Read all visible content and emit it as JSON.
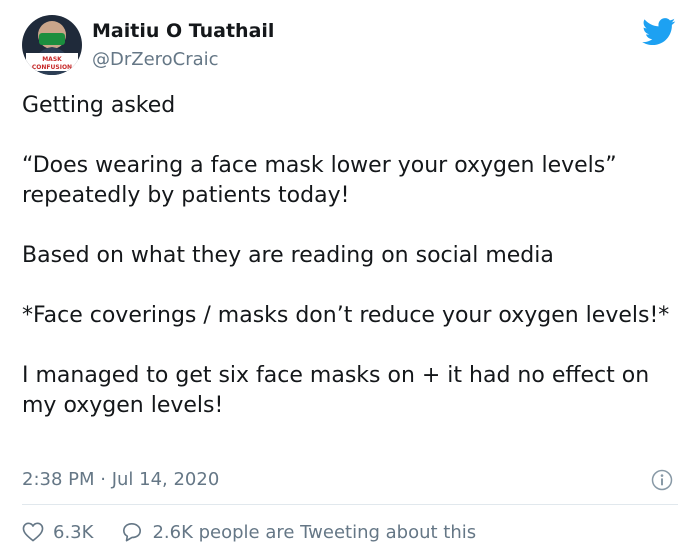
{
  "author": {
    "name": "Maitiu O Tuathail",
    "handle": "@DrZeroCraic",
    "avatar_caption_line1": "MASK",
    "avatar_caption_line2": "CONFUSION"
  },
  "tweet": {
    "lines": [
      "Getting asked",
      "“Does wearing a face mask lower your oxygen levels” repeatedly by patients today!",
      "Based on what they are reading on social media",
      "*Face coverings / masks don’t reduce your oxygen levels!*",
      "I managed to get six face masks on + it had no effect on my oxygen levels!"
    ],
    "timestamp": "2:38 PM · Jul 14, 2020"
  },
  "stats": {
    "likes": "6.3K",
    "conversation": "2.6K people are Tweeting about this"
  },
  "icons": {
    "brand": "twitter-bird-icon",
    "info": "info-icon",
    "like": "heart-icon",
    "reply": "speech-bubble-icon"
  },
  "colors": {
    "twitter_blue": "#1da1f2",
    "text": "#14171a",
    "secondary": "#657786",
    "divider": "#e1e8ed"
  }
}
